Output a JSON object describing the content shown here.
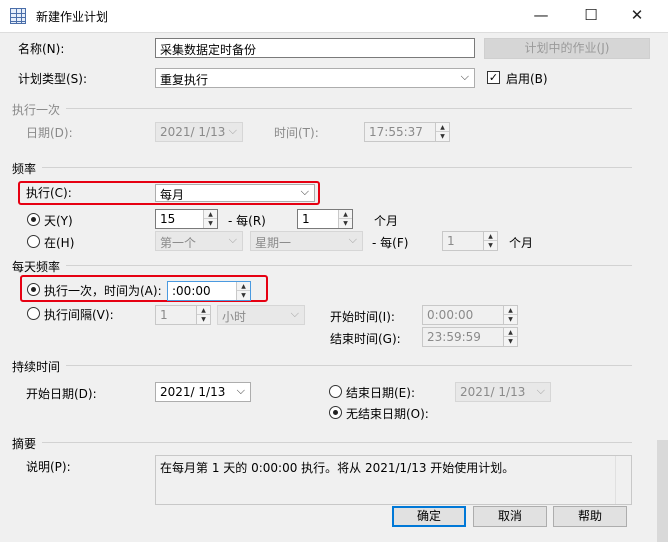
{
  "window": {
    "title": "新建作业计划",
    "minimize": "—",
    "maximize": "☐",
    "close": "✕"
  },
  "name": {
    "label": "名称(N):",
    "value": "采集数据定时备份",
    "jobs_button": "计划中的作业(J)"
  },
  "schedule_type": {
    "label": "计划类型(S):",
    "value": "重复执行",
    "enabled_label": "启用(B)",
    "enabled": true
  },
  "once": {
    "group": "执行一次",
    "date_label": "日期(D):",
    "date_value": "2021/ 1/13",
    "time_label": "时间(T):",
    "time_value": "17:55:37"
  },
  "frequency": {
    "group": "频率",
    "exec_label": "执行(C):",
    "exec_value": "每月",
    "day_label": "天(Y)",
    "day_value": "15",
    "every_label": "- 每(R)",
    "every_value": "1",
    "month_unit": "个月",
    "on_label": "在(H)",
    "on_which": "第一个",
    "on_weekday": "星期一",
    "every2_label": "- 每(F)",
    "every2_value": "1",
    "month_unit2": "个月"
  },
  "daily": {
    "group": "每天频率",
    "once_label": "执行一次，时间为(A):",
    "once_time": ":00:00",
    "interval_label": "执行间隔(V):",
    "interval_value": "1",
    "interval_unit": "小时",
    "start_label": "开始时间(I):",
    "start_value": "0:00:00",
    "end_label": "结束时间(G):",
    "end_value": "23:59:59"
  },
  "duration": {
    "group": "持续时间",
    "start_label": "开始日期(D):",
    "start_value": "2021/ 1/13",
    "end_label": "结束日期(E):",
    "end_value": "2021/ 1/13",
    "no_end_label": "无结束日期(O):"
  },
  "summary": {
    "group": "摘要",
    "desc_label": "说明(P):",
    "desc_value": "在每月第 1 天的 0:00:00 执行。将从 2021/1/13 开始使用计划。"
  },
  "buttons": {
    "ok": "确定",
    "cancel": "取消",
    "help": "帮助"
  },
  "colors": {
    "highlight": "#e60012",
    "accent": "#0078d7"
  }
}
